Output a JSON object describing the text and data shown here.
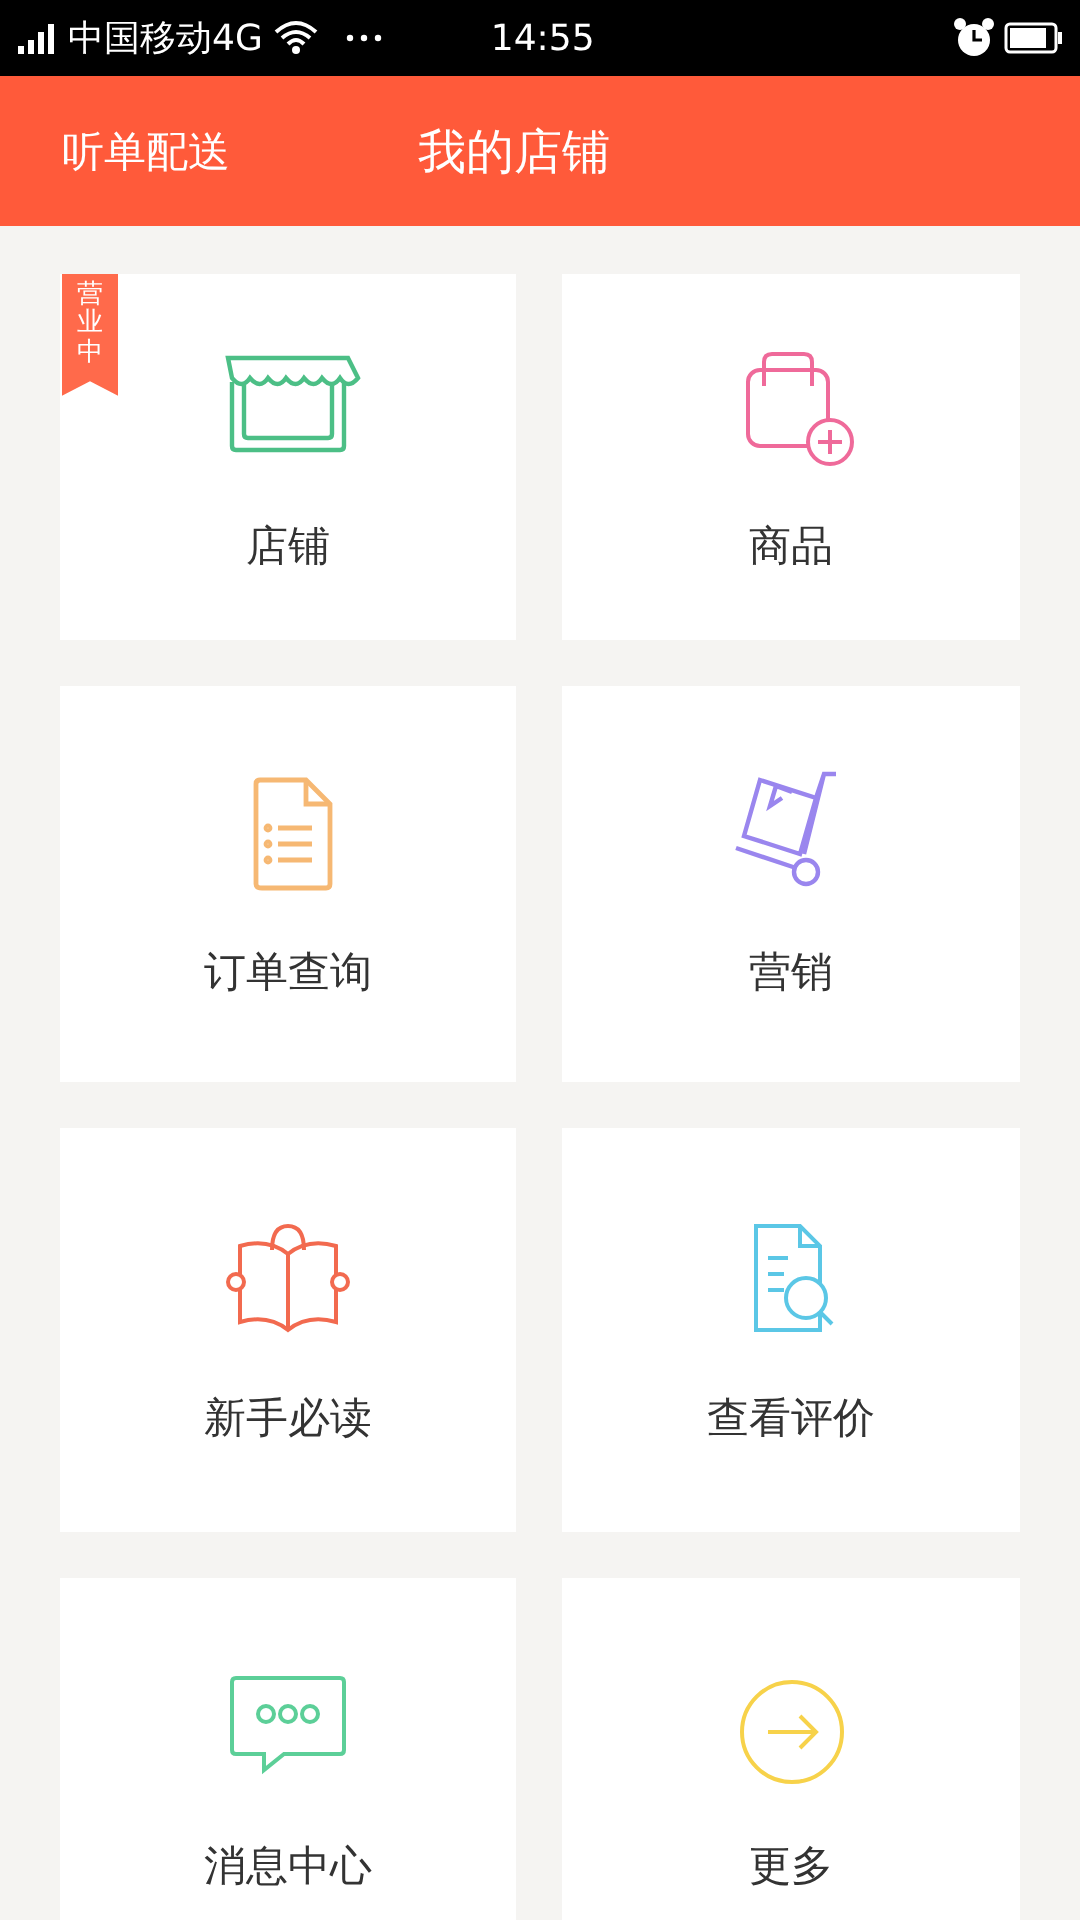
{
  "status_bar": {
    "carrier": "中国移动4G",
    "time": "14:55"
  },
  "header": {
    "left_action": "听单配送",
    "title": "我的店铺"
  },
  "tiles": [
    {
      "label": "店铺",
      "badge": "营业中"
    },
    {
      "label": "商品"
    },
    {
      "label": "订单查询"
    },
    {
      "label": "营销"
    },
    {
      "label": "新手必读"
    },
    {
      "label": "查看评价"
    },
    {
      "label": "消息中心"
    },
    {
      "label": "更多"
    }
  ]
}
